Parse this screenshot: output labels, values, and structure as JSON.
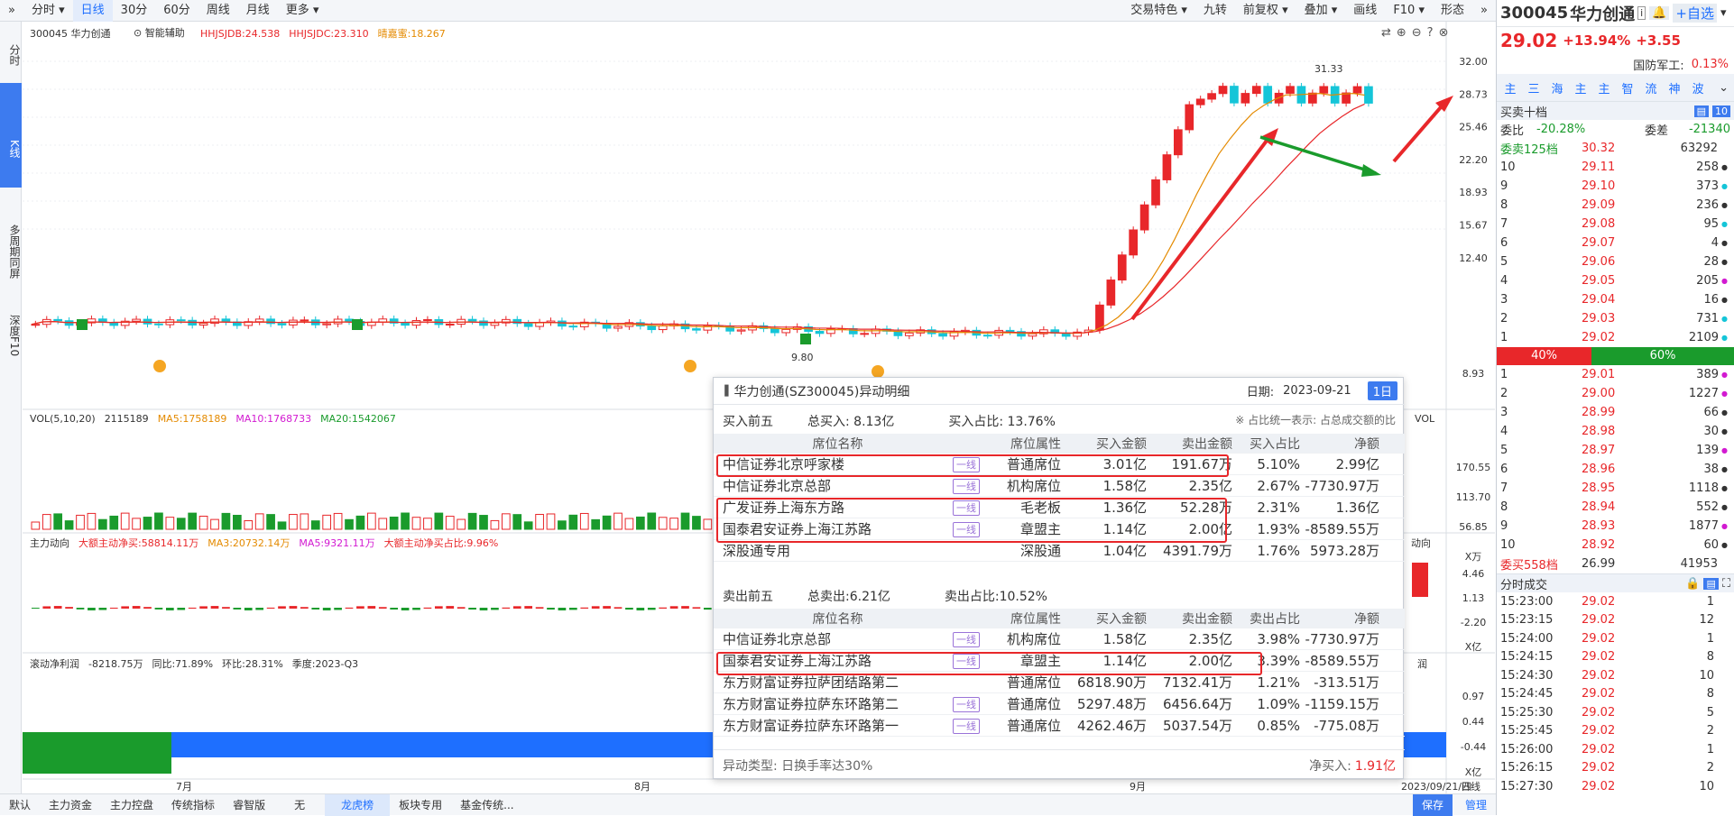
{
  "toolbar": {
    "collapse": "»",
    "items": [
      "分时",
      "日线",
      "30分",
      "60分",
      "周线",
      "月线",
      "更多"
    ],
    "right": [
      "交易特色",
      "九转",
      "前复权",
      "叠加",
      "画线",
      "F10",
      "形态"
    ],
    "far": "»"
  },
  "leftrail": [
    "分时",
    "K线",
    "多周期同屏",
    "深度F10"
  ],
  "chart": {
    "title": "300045 华力创通",
    "assist": "智能辅助",
    "ma_labels": [
      {
        "t": "HHJSJDB:24.538",
        "c": "#e8272a"
      },
      {
        "t": "HHJSJDC:23.310",
        "c": "#e8272a"
      },
      {
        "t": "晴嘉蜜:18.267",
        "c": "#e48a00"
      }
    ],
    "yticks": [
      "32.00",
      "28.73",
      "25.46",
      "22.20",
      "18.93",
      "15.67",
      "12.40",
      "8.93"
    ],
    "high_label": "31.33",
    "low_label": "9.80",
    "vol_labels": [
      {
        "t": "VOL(5,10,20)",
        "c": "#333"
      },
      {
        "t": "2115189",
        "c": "#333"
      },
      {
        "t": "MA5:1758189",
        "c": "#e48a00"
      },
      {
        "t": "MA10:1768733",
        "c": "#d21ad1"
      },
      {
        "t": "MA20:1542067",
        "c": "#1a9b2c"
      }
    ],
    "vol_yticks": [
      "170.55",
      "113.70",
      "56.85",
      "X万"
    ],
    "flow_labels": [
      {
        "t": "主力动向",
        "c": "#333"
      },
      {
        "t": "大额主动净买:58814.11万",
        "c": "#e8272a"
      },
      {
        "t": "MA3:20732.14万",
        "c": "#e48a00"
      },
      {
        "t": "MA5:9321.11万",
        "c": "#d21ad1"
      },
      {
        "t": "大额主动净买占比:9.96%",
        "c": "#e8272a"
      }
    ],
    "flow_yticks": [
      "4.46",
      "1.13",
      "-2.20",
      "X亿"
    ],
    "profit_labels": [
      {
        "t": "滚动净利润",
        "c": "#333"
      },
      {
        "t": "-8218.75万",
        "c": "#333"
      },
      {
        "t": "同比:71.89%",
        "c": "#333"
      },
      {
        "t": "环比:28.31%",
        "c": "#333"
      },
      {
        "t": "季度:2023-Q3",
        "c": "#333"
      }
    ],
    "profit_yticks": [
      "0.97",
      "0.44",
      "-0.44",
      "X亿"
    ],
    "xlabels": [
      "7月",
      "8月",
      "9月",
      "2023/09/21/四"
    ],
    "xaxis_right": "日线",
    "right_label_vol": "VOL",
    "right_label_flow": "动向",
    "right_label_profit": "润"
  },
  "bottombar": [
    "默认",
    "主力资金",
    "主力控盘",
    "传统指标",
    "睿智版",
    "无",
    "龙虎榜",
    "板块专用",
    "基金传统..."
  ],
  "bottom_right": [
    "保存",
    "管理"
  ],
  "popup": {
    "title": "华力创通(SZ300045)异动明细",
    "date_label": "日期:",
    "date": "2023-09-21",
    "date_btn": "1日",
    "buy_title": "买入前五",
    "buy_total": "总买入: 8.13亿",
    "buy_ratio": "买入占比: 13.76%",
    "note": "※ 占比统一表示: 占总成交额的比",
    "headers": [
      "席位名称",
      "席位属性",
      "买入金额",
      "卖出金额",
      "买入占比",
      "净额"
    ],
    "sell_headers": [
      "席位名称",
      "席位属性",
      "买入金额",
      "卖出金额",
      "卖出占比",
      "净额"
    ],
    "tag": "一线",
    "buy_rows": [
      [
        "中信证券北京呼家楼",
        "普通席位",
        "3.01亿",
        "191.67万",
        "5.10%",
        "2.99亿",
        true
      ],
      [
        "中信证券北京总部",
        "机构席位",
        "1.58亿",
        "2.35亿",
        "2.67%",
        "-7730.97万",
        true
      ],
      [
        "广发证券上海东方路",
        "毛老板",
        "1.36亿",
        "52.28万",
        "2.31%",
        "1.36亿",
        true
      ],
      [
        "国泰君安证券上海江苏路",
        "章盟主",
        "1.14亿",
        "2.00亿",
        "1.93%",
        "-8589.55万",
        true
      ],
      [
        "深股通专用",
        "深股通",
        "1.04亿",
        "4391.79万",
        "1.76%",
        "5973.28万",
        false
      ]
    ],
    "sell_title": "卖出前五",
    "sell_total": "总卖出:6.21亿",
    "sell_ratio": "卖出占比:10.52%",
    "sell_rows": [
      [
        "中信证券北京总部",
        "机构席位",
        "1.58亿",
        "2.35亿",
        "3.98%",
        "-7730.97万",
        true
      ],
      [
        "国泰君安证券上海江苏路",
        "章盟主",
        "1.14亿",
        "2.00亿",
        "3.39%",
        "-8589.55万",
        true
      ],
      [
        "东方财富证券拉萨团结路第二",
        "普通席位",
        "6818.90万",
        "7132.41万",
        "1.21%",
        "-313.51万",
        false
      ],
      [
        "东方财富证券拉萨东环路第二",
        "普通席位",
        "5297.48万",
        "6456.64万",
        "1.09%",
        "-1159.15万",
        true
      ],
      [
        "东方财富证券拉萨东环路第一",
        "普通席位",
        "4262.46万",
        "5037.54万",
        "0.85%",
        "-775.08万",
        true
      ]
    ],
    "footer_type": "异动类型: 日换手率达30%",
    "footer_net_label": "净买入:",
    "footer_net": "1.91亿"
  },
  "quote": {
    "code": "300045",
    "name": "华力创通",
    "add": "+自选",
    "price": "29.02",
    "change_pct": "+13.94%",
    "change": "+3.55",
    "industry": "国防军工:",
    "industry_pct": "0.13%",
    "tabs": [
      "主",
      "三",
      "海",
      "主",
      "主",
      "智",
      "流",
      "神",
      "波"
    ],
    "level_title": "买卖十档",
    "ratio_label": "委比",
    "ratio": "-20.28%",
    "diff_label": "委差",
    "diff": "-21340",
    "ask_total_label": "委卖125档",
    "ask_total_price": "30.32",
    "ask_total_vol": "63292",
    "asks": [
      [
        "10",
        "29.11",
        "258",
        "#333"
      ],
      [
        "9",
        "29.10",
        "373",
        "#15c5d8"
      ],
      [
        "8",
        "29.09",
        "236",
        "#333"
      ],
      [
        "7",
        "29.08",
        "95",
        "#15c5d8"
      ],
      [
        "6",
        "29.07",
        "4",
        "#333"
      ],
      [
        "5",
        "29.06",
        "28",
        "#333"
      ],
      [
        "4",
        "29.05",
        "205",
        "#d21ad1"
      ],
      [
        "3",
        "29.04",
        "16",
        "#333"
      ],
      [
        "2",
        "29.03",
        "731",
        "#15c5d8"
      ],
      [
        "1",
        "29.02",
        "2109",
        "#15c5d8"
      ]
    ],
    "buy_pct": "40%",
    "sell_pct": "60%",
    "bids": [
      [
        "1",
        "29.01",
        "389",
        "#d21ad1"
      ],
      [
        "2",
        "29.00",
        "1227",
        "#d21ad1"
      ],
      [
        "3",
        "28.99",
        "66",
        "#333"
      ],
      [
        "4",
        "28.98",
        "30",
        "#333"
      ],
      [
        "5",
        "28.97",
        "139",
        "#d21ad1"
      ],
      [
        "6",
        "28.96",
        "38",
        "#333"
      ],
      [
        "7",
        "28.95",
        "1118",
        "#333"
      ],
      [
        "8",
        "28.94",
        "552",
        "#333"
      ],
      [
        "9",
        "28.93",
        "1877",
        "#d21ad1"
      ],
      [
        "10",
        "28.92",
        "60",
        "#333"
      ]
    ],
    "bid_total_label": "委买558档",
    "bid_total_price": "26.99",
    "bid_total_vol": "41953",
    "trades_title": "分时成交",
    "trades": [
      [
        "15:23:00",
        "29.02",
        "1"
      ],
      [
        "15:23:15",
        "29.02",
        "12"
      ],
      [
        "15:24:00",
        "29.02",
        "1"
      ],
      [
        "15:24:15",
        "29.02",
        "8"
      ],
      [
        "15:24:30",
        "29.02",
        "10"
      ],
      [
        "15:24:45",
        "29.02",
        "8"
      ],
      [
        "15:25:30",
        "29.02",
        "5"
      ],
      [
        "15:25:45",
        "29.02",
        "2"
      ],
      [
        "15:26:00",
        "29.02",
        "1"
      ],
      [
        "15:26:15",
        "29.02",
        "2"
      ],
      [
        "15:27:30",
        "29.02",
        "10"
      ]
    ]
  }
}
